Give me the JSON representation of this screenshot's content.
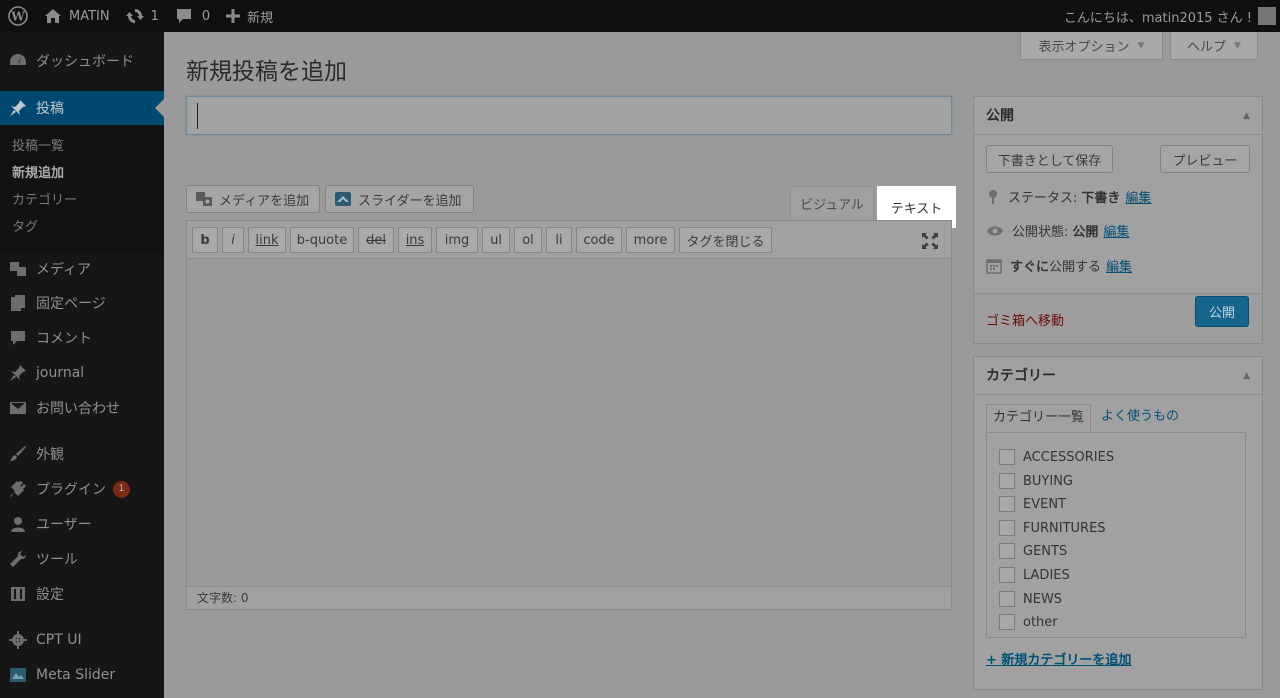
{
  "adminbar": {
    "site_name": "MATIN",
    "updates_count": "1",
    "comments_count": "0",
    "new_label": "新規",
    "greeting": "こんにちは、matin2015 さん !"
  },
  "sidebar": {
    "dashboard": "ダッシュボード",
    "posts": "投稿",
    "submenu": [
      "投稿一覧",
      "新規追加",
      "カテゴリー",
      "タグ"
    ],
    "media": "メディア",
    "pages": "固定ページ",
    "comments": "コメント",
    "journal": "journal",
    "contact": "お問い合わせ",
    "appearance": "外観",
    "plugins": "プラグイン",
    "plugins_badge": "1",
    "users": "ユーザー",
    "tools": "ツール",
    "settings": "設定",
    "cptui": "CPT UI",
    "metaslider": "Meta Slider"
  },
  "screen_meta": {
    "screen_options": "表示オプション",
    "help": "ヘルプ"
  },
  "page_title": "新規投稿を追加",
  "title_input": {
    "value": ""
  },
  "media_buttons": {
    "add_media": "メディアを追加",
    "add_slider": "スライダーを追加"
  },
  "editor_tabs": {
    "visual": "ビジュアル",
    "text": "テキスト"
  },
  "quicktags": [
    "b",
    "i",
    "link",
    "b-quote",
    "del",
    "ins",
    "img",
    "ul",
    "ol",
    "li",
    "code",
    "more",
    "タグを閉じる"
  ],
  "editor": {
    "content": "",
    "word_count": "文字数: 0"
  },
  "publish": {
    "title": "公開",
    "save_draft": "下書きとして保存",
    "preview": "プレビュー",
    "status_label": "ステータス:",
    "status_value": "下書き",
    "visibility_label": "公開状態:",
    "visibility_value": "公開",
    "schedule_bold": "すぐに",
    "schedule_rest": "公開する",
    "edit": "編集",
    "trash": "ゴミ箱へ移動",
    "publish_button": "公開"
  },
  "categories": {
    "title": "カテゴリー",
    "tab_all": "カテゴリー一覧",
    "tab_popular": "よく使うもの",
    "items": [
      "ACCESSORIES",
      "BUYING",
      "EVENT",
      "FURNITURES",
      "GENTS",
      "LADIES",
      "NEWS",
      "other"
    ],
    "add_new": "+ 新規カテゴリーを追加"
  }
}
